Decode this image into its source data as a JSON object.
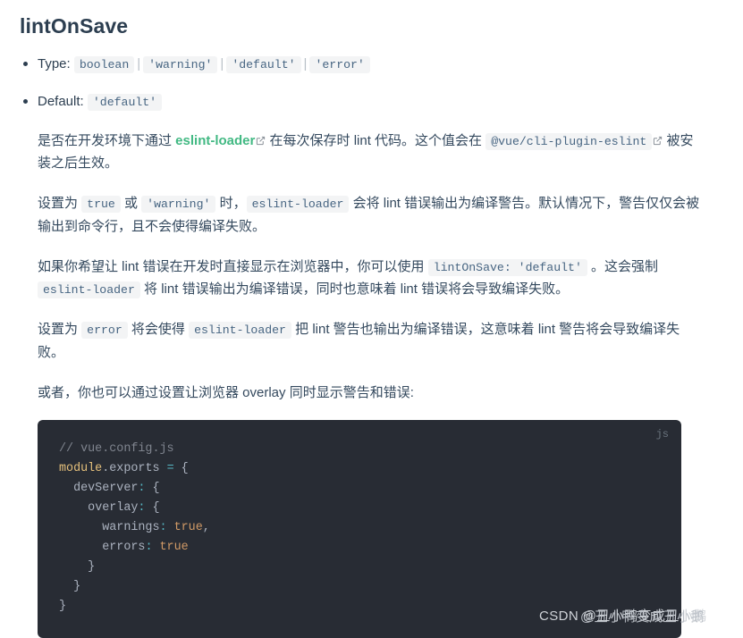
{
  "heading": "lintOnSave",
  "meta_list": [
    {
      "label": "Type:",
      "values": [
        "boolean",
        "'warning'",
        "'default'",
        "'error'"
      ],
      "separator": "|"
    },
    {
      "label": "Default:",
      "values": [
        "'default'"
      ]
    }
  ],
  "paragraphs": {
    "p1": {
      "t1": "是否在开发环境下通过 ",
      "link": "eslint-loader",
      "t2": " 在每次保存时 lint 代码。这个值会在 ",
      "code": "@vue/cli-plugin-eslint",
      "t3": " 被安装之后生效。"
    },
    "p2": {
      "t1": "设置为 ",
      "c1": "true",
      "t2": " 或 ",
      "c2": "'warning'",
      "t3": " 时，",
      "c3": "eslint-loader",
      "t4": " 会将 lint 错误输出为编译警告。默认情况下，警告仅仅会被输出到命令行，且不会使得编译失败。"
    },
    "p3": {
      "t1": "如果你希望让 lint 错误在开发时直接显示在浏览器中，你可以使用 ",
      "c1": "lintOnSave: 'default'",
      "t2": " 。这会强制 ",
      "c2": "eslint-loader",
      "t3": " 将 lint 错误输出为编译错误，同时也意味着 lint 错误将会导致编译失败。"
    },
    "p4": {
      "t1": "设置为 ",
      "c1": "error",
      "t2": " 将会使得 ",
      "c2": "eslint-loader",
      "t3": " 把 lint 警告也输出为编译错误，这意味着 lint 警告将会导致编译失败。"
    },
    "p5": {
      "t1": "或者，你也可以通过设置让浏览器 overlay 同时显示警告和错误:"
    }
  },
  "codeblock": {
    "lang_label": "js",
    "lines": [
      {
        "indent": 0,
        "parts": [
          {
            "cls": "tok-comment",
            "text": "// vue.config.js"
          }
        ]
      },
      {
        "indent": 0,
        "parts": [
          {
            "cls": "tok-obj",
            "text": "module"
          },
          {
            "cls": "tok-punc",
            "text": "."
          },
          {
            "cls": "tok-prop",
            "text": "exports"
          },
          {
            "cls": "tok-punc",
            "text": " "
          },
          {
            "cls": "tok-op",
            "text": "="
          },
          {
            "cls": "tok-brace",
            "text": " {"
          }
        ]
      },
      {
        "indent": 2,
        "parts": [
          {
            "cls": "tok-prop",
            "text": "devServer"
          },
          {
            "cls": "tok-op",
            "text": ":"
          },
          {
            "cls": "tok-brace",
            "text": " {"
          }
        ]
      },
      {
        "indent": 4,
        "parts": [
          {
            "cls": "tok-prop",
            "text": "overlay"
          },
          {
            "cls": "tok-op",
            "text": ":"
          },
          {
            "cls": "tok-brace",
            "text": " {"
          }
        ]
      },
      {
        "indent": 6,
        "parts": [
          {
            "cls": "tok-prop",
            "text": "warnings"
          },
          {
            "cls": "tok-op",
            "text": ":"
          },
          {
            "cls": "tok-bool",
            "text": " true"
          },
          {
            "cls": "tok-punc",
            "text": ","
          }
        ]
      },
      {
        "indent": 6,
        "parts": [
          {
            "cls": "tok-prop",
            "text": "errors"
          },
          {
            "cls": "tok-op",
            "text": ":"
          },
          {
            "cls": "tok-bool",
            "text": " true"
          }
        ]
      },
      {
        "indent": 4,
        "parts": [
          {
            "cls": "tok-brace",
            "text": "}"
          }
        ]
      },
      {
        "indent": 2,
        "parts": [
          {
            "cls": "tok-brace",
            "text": "}"
          }
        ]
      },
      {
        "indent": 0,
        "parts": [
          {
            "cls": "tok-brace",
            "text": "}"
          }
        ]
      }
    ]
  },
  "watermark": {
    "text": "CSDN @丑小鸭变成丑小鹅",
    "duplicate": "@丑小鸭变成丑小鹅"
  },
  "colors": {
    "heading": "#2c3e50",
    "link_accent": "#42b983",
    "inline_code_bg": "#f3f4f5",
    "inline_code_fg": "#476582",
    "code_bg": "#282c34",
    "bool_token": "#d19a66",
    "comment_token": "#7f848e"
  }
}
